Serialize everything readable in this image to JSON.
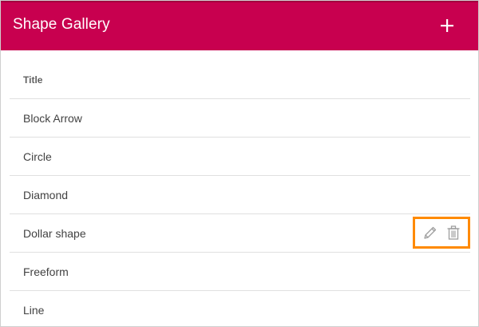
{
  "header": {
    "title": "Shape Gallery",
    "add_icon": "plus-icon",
    "background": "#c8004f"
  },
  "table": {
    "column_title": "Title",
    "rows": [
      {
        "label": "Block Arrow"
      },
      {
        "label": "Circle"
      },
      {
        "label": "Diamond"
      },
      {
        "label": "Dollar shape",
        "hovered": true
      },
      {
        "label": "Freeform"
      },
      {
        "label": "Line"
      }
    ]
  },
  "row_actions": {
    "edit_icon": "pencil-icon",
    "delete_icon": "trash-icon",
    "highlight_color": "#ff8a00"
  }
}
